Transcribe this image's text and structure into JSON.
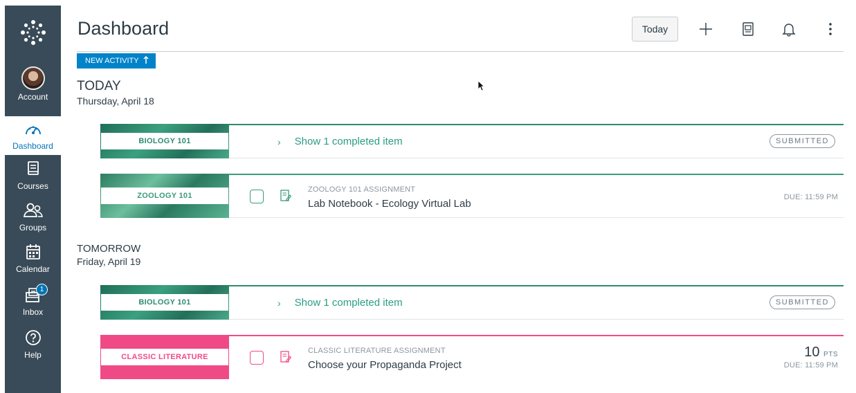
{
  "colors": {
    "nav_bg": "#394b58",
    "accent": "#0374b5",
    "biology": "#2e8b6f",
    "zoology": "#3a9a7a",
    "classic_literature": "#f04a86",
    "success_text": "#2b9c83"
  },
  "nav": {
    "logo_icon": "canvas-logo-icon",
    "items": [
      {
        "label": "Account",
        "icon": "avatar"
      },
      {
        "label": "Dashboard",
        "icon": "dashboard-gauge-icon"
      },
      {
        "label": "Courses",
        "icon": "courses-book-icon"
      },
      {
        "label": "Groups",
        "icon": "groups-people-icon"
      },
      {
        "label": "Calendar",
        "icon": "calendar-icon"
      },
      {
        "label": "Inbox",
        "icon": "inbox-icon",
        "badge": "1"
      },
      {
        "label": "Help",
        "icon": "help-question-icon"
      }
    ]
  },
  "header": {
    "title": "Dashboard",
    "today_button": "Today",
    "icons": [
      "add-icon",
      "grades-icon",
      "bell-icon",
      "kebab-menu-icon"
    ]
  },
  "new_activity": {
    "label": "NEW ACTIVITY",
    "icon": "arrow-up-icon"
  },
  "days": [
    {
      "heading": "TODAY",
      "date": "Thursday, April 18",
      "items": [
        {
          "course": "BIOLOGY 101",
          "text": "Show 1 completed item",
          "status": "SUBMITTED"
        },
        {
          "course": "ZOOLOGY 101",
          "type": "ZOOLOGY 101 ASSIGNMENT",
          "title": "Lab Notebook - Ecology Virtual Lab",
          "due": "DUE: 11:59 PM"
        }
      ]
    },
    {
      "heading": "TOMORROW",
      "date": "Friday, April 19",
      "items": [
        {
          "course": "BIOLOGY 101",
          "text": "Show 1 completed item",
          "status": "SUBMITTED"
        },
        {
          "course": "CLASSIC LITERATURE",
          "type": "CLASSIC LITERATURE ASSIGNMENT",
          "title": "Choose your Propaganda Project",
          "points": "10",
          "points_unit": "PTS",
          "due": "DUE: 11:59 PM"
        }
      ]
    }
  ]
}
